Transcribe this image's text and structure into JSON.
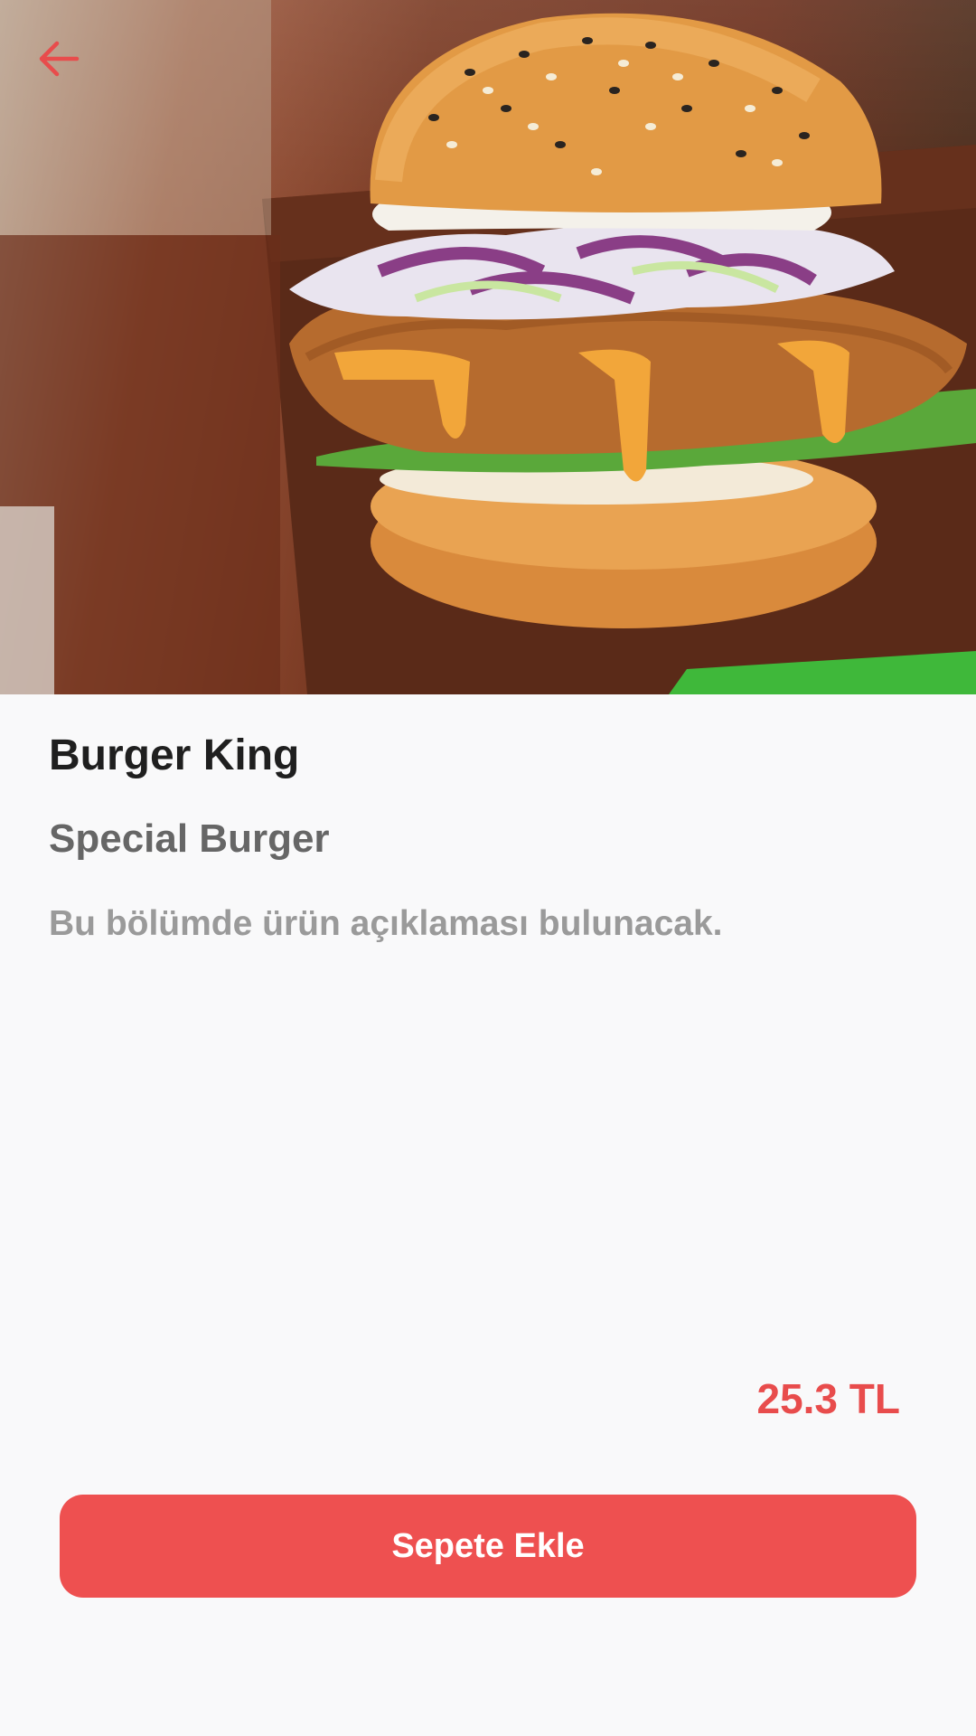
{
  "header": {
    "back_icon": "arrow-left-icon"
  },
  "hero": {
    "image": "burger-photo"
  },
  "product": {
    "restaurant": "Burger King",
    "name": "Special Burger",
    "description": "Bu bölümde ürün açıklaması bulunacak.",
    "price": "25.3 TL"
  },
  "actions": {
    "add_to_cart_label": "Sepete Ekle"
  },
  "colors": {
    "accent": "#ee5050",
    "price": "#e84c4c",
    "title": "#1f1f1f",
    "subtitle": "#666666",
    "description": "#9a9a9a",
    "background": "#f9f9fa"
  }
}
